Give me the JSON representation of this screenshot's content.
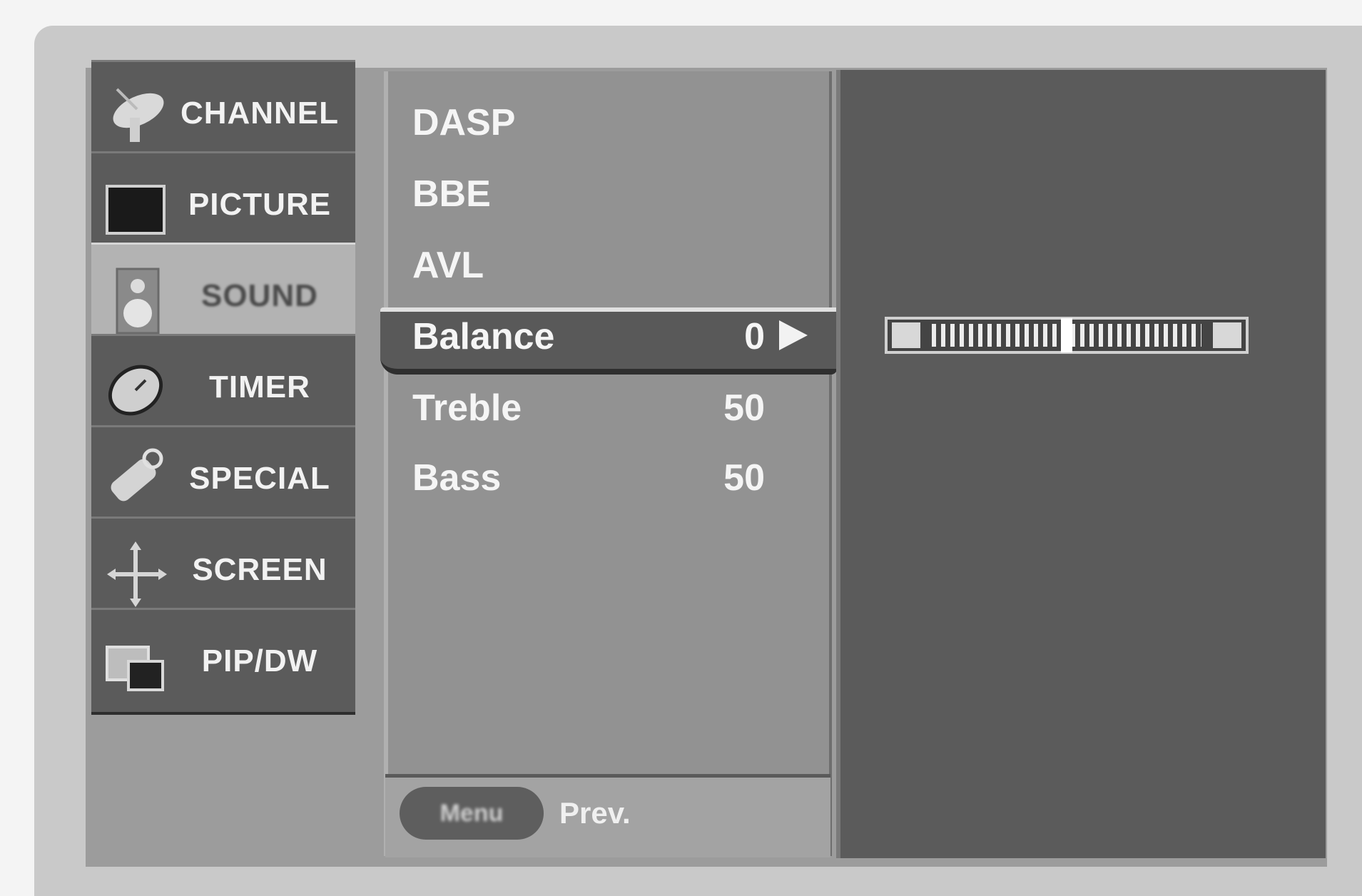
{
  "sidebar": {
    "items": [
      {
        "label": "CHANNEL",
        "icon": "satellite-dish-icon"
      },
      {
        "label": "PICTURE",
        "icon": "tv-screen-icon"
      },
      {
        "label": "SOUND",
        "icon": "speaker-icon",
        "active": true
      },
      {
        "label": "TIMER",
        "icon": "clock-icon"
      },
      {
        "label": "SPECIAL",
        "icon": "key-tag-icon"
      },
      {
        "label": "SCREEN",
        "icon": "move-arrows-icon"
      },
      {
        "label": "PIP/DW",
        "icon": "pip-windows-icon"
      }
    ]
  },
  "sound_menu": {
    "items": [
      {
        "label": "DASP"
      },
      {
        "label": "BBE"
      },
      {
        "label": "AVL"
      },
      {
        "label": "Balance",
        "value": "0",
        "selected": true
      },
      {
        "label": "Treble",
        "value": "50"
      },
      {
        "label": "Bass",
        "value": "50"
      }
    ]
  },
  "balance_slider": {
    "value": 0,
    "min": -50,
    "max": 50
  },
  "footer": {
    "menu_button": "Menu",
    "prev_label": "Prev."
  }
}
